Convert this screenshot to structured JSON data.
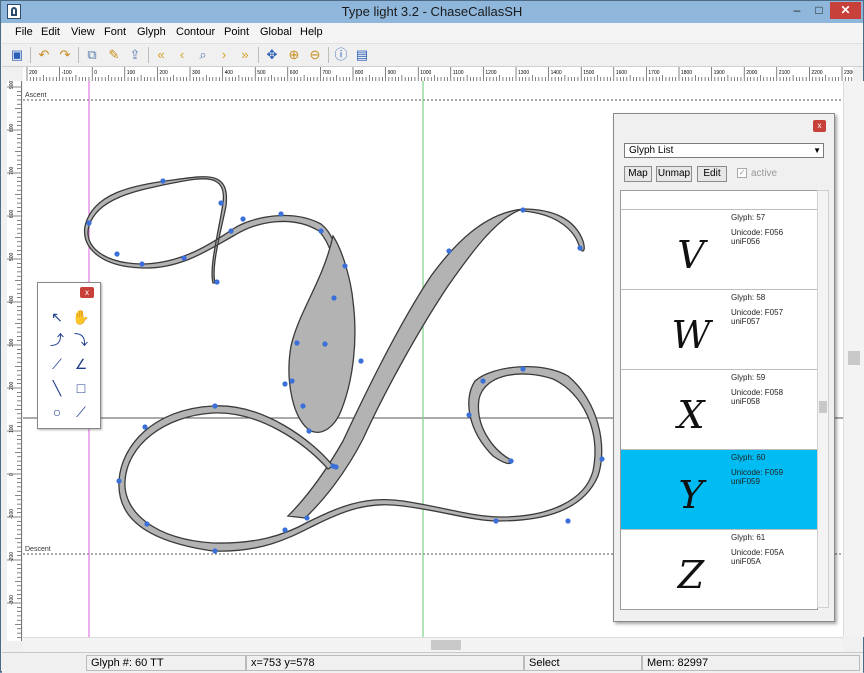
{
  "window": {
    "title": "Type light 3.2  -  ChaseCallasSH",
    "min_label": "–",
    "max_label": "□",
    "close_label": "✕"
  },
  "menu": [
    "File",
    "Edit",
    "View",
    "Font",
    "Glyph",
    "Contour",
    "Point",
    "Global",
    "Help"
  ],
  "toolbar_icons": [
    "save-icon",
    "undo-icon",
    "redo-icon",
    "copy-glyph-icon",
    "paste-glyph-icon",
    "export-icon",
    "first-glyph-icon",
    "prev-glyph-icon",
    "find-glyph-icon",
    "next-glyph-icon",
    "last-glyph-icon",
    "move-icon",
    "zoom-in-icon",
    "zoom-out-icon",
    "info-icon",
    "panel-icon"
  ],
  "ruler": {
    "h_labels": [
      "200",
      "-100",
      "0",
      "100",
      "200",
      "300",
      "400",
      "500",
      "600",
      "700",
      "800",
      "900",
      "1000",
      "1100",
      "1200",
      "1300",
      "1400",
      "1500",
      "1600",
      "1700",
      "1800",
      "1900",
      "2000",
      "2100",
      "2200",
      "2300",
      "2400"
    ],
    "v_labels": [
      "900",
      "800",
      "700",
      "600",
      "500",
      "400",
      "300",
      "200",
      "100",
      "0",
      "-100",
      "-200",
      "-300"
    ]
  },
  "canvas": {
    "ascent_label": "Ascent",
    "descent_label": "Descent",
    "colors": {
      "fill": "#b3b3b3",
      "stroke": "#3a3a3a",
      "point": "#3b6fd9",
      "left_bearing": "#e07ae0",
      "right_bearing": "#7fd38a"
    }
  },
  "tool_palette": {
    "close_label": "x",
    "tools": [
      "pointer-tool-icon",
      "hand-tool-icon",
      "curve-point-tool-icon",
      "smooth-curve-tool-icon",
      "corner-point-tool-icon",
      "tangent-point-tool-icon",
      "line-tool-icon",
      "rectangle-tool-icon",
      "ellipse-tool-icon",
      "knife-tool-icon"
    ]
  },
  "glyph_panel": {
    "close_label": "x",
    "list_type": "Glyph List",
    "buttons": {
      "map": "Map",
      "unmap": "Unmap",
      "edit": "Edit"
    },
    "active_label": "active",
    "glyphs": [
      {
        "glyph_label": "Glyph: 57",
        "unicode_label": "Unicode: F056",
        "name": "uniF056",
        "char": "V",
        "selected": false
      },
      {
        "glyph_label": "Glyph: 58",
        "unicode_label": "Unicode: F057",
        "name": "uniF057",
        "char": "W",
        "selected": false
      },
      {
        "glyph_label": "Glyph: 59",
        "unicode_label": "Unicode: F058",
        "name": "uniF058",
        "char": "X",
        "selected": false
      },
      {
        "glyph_label": "Glyph: 60",
        "unicode_label": "Unicode: F059",
        "name": "uniF059",
        "char": "Y",
        "selected": true
      },
      {
        "glyph_label": "Glyph: 61",
        "unicode_label": "Unicode: F05A",
        "name": "uniF05A",
        "char": "Z",
        "selected": false
      }
    ],
    "selected_color": "#00bcf2"
  },
  "status": {
    "glyph": "Glyph #: 60   TT",
    "coords": "x=753  y=578",
    "mode": "Select",
    "memory": "Mem: 82997"
  }
}
